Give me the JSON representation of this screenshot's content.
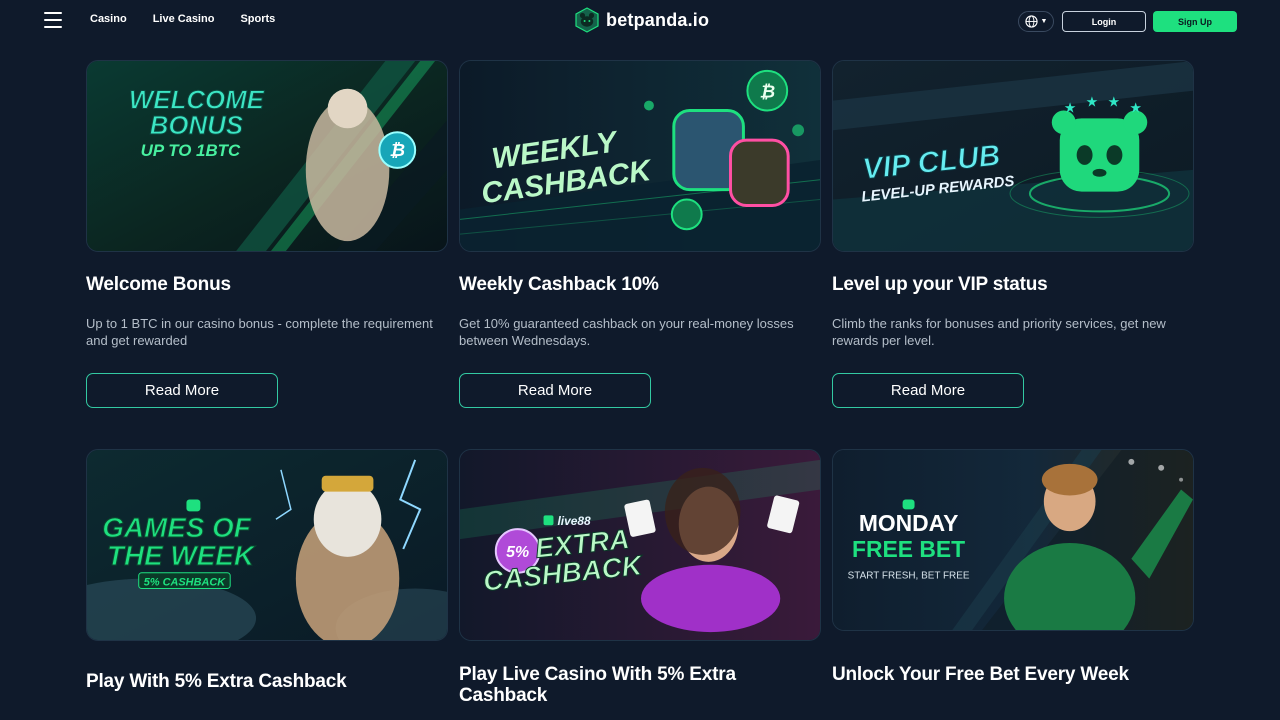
{
  "header": {
    "nav": [
      "Casino",
      "Live Casino",
      "Sports"
    ],
    "logo_text": "betpanda.io",
    "login_label": "Login",
    "signup_label": "Sign Up"
  },
  "colors": {
    "background": "#0f1a2b",
    "accent": "#1ee07f",
    "button_border": "#33c9a2"
  },
  "promos": [
    {
      "banner_lines": [
        "WELCOME",
        "BONUS",
        "UP TO 1BTC"
      ],
      "title": "Welcome Bonus",
      "description": "Up to 1 BTC in our casino bonus - complete the requirement and get rewarded",
      "button": "Read More"
    },
    {
      "banner_lines": [
        "WEEKLY",
        "CASHBACK"
      ],
      "title": "Weekly Cashback 10%",
      "description": "Get 10% guaranteed cashback on your real-money losses between Wednesdays.",
      "button": "Read More"
    },
    {
      "banner_lines": [
        "VIP CLUB",
        "LEVEL-UP REWARDS"
      ],
      "title": "Level up your VIP status",
      "description": "Climb the ranks for bonuses and priority services, get new rewards per level.",
      "button": "Read More"
    },
    {
      "banner_lines": [
        "GAMES OF",
        "THE WEEK",
        "5% CASHBACK"
      ],
      "title": "Play With 5% Extra Cashback"
    },
    {
      "banner_lines": [
        "live88",
        "5%",
        "EXTRA",
        "CASHBACK"
      ],
      "title": "Play Live Casino With 5% Extra Cashback"
    },
    {
      "banner_lines": [
        "MONDAY",
        "FREE BET",
        "START FRESH, BET FREE"
      ],
      "title": "Unlock Your Free Bet Every Week"
    }
  ]
}
